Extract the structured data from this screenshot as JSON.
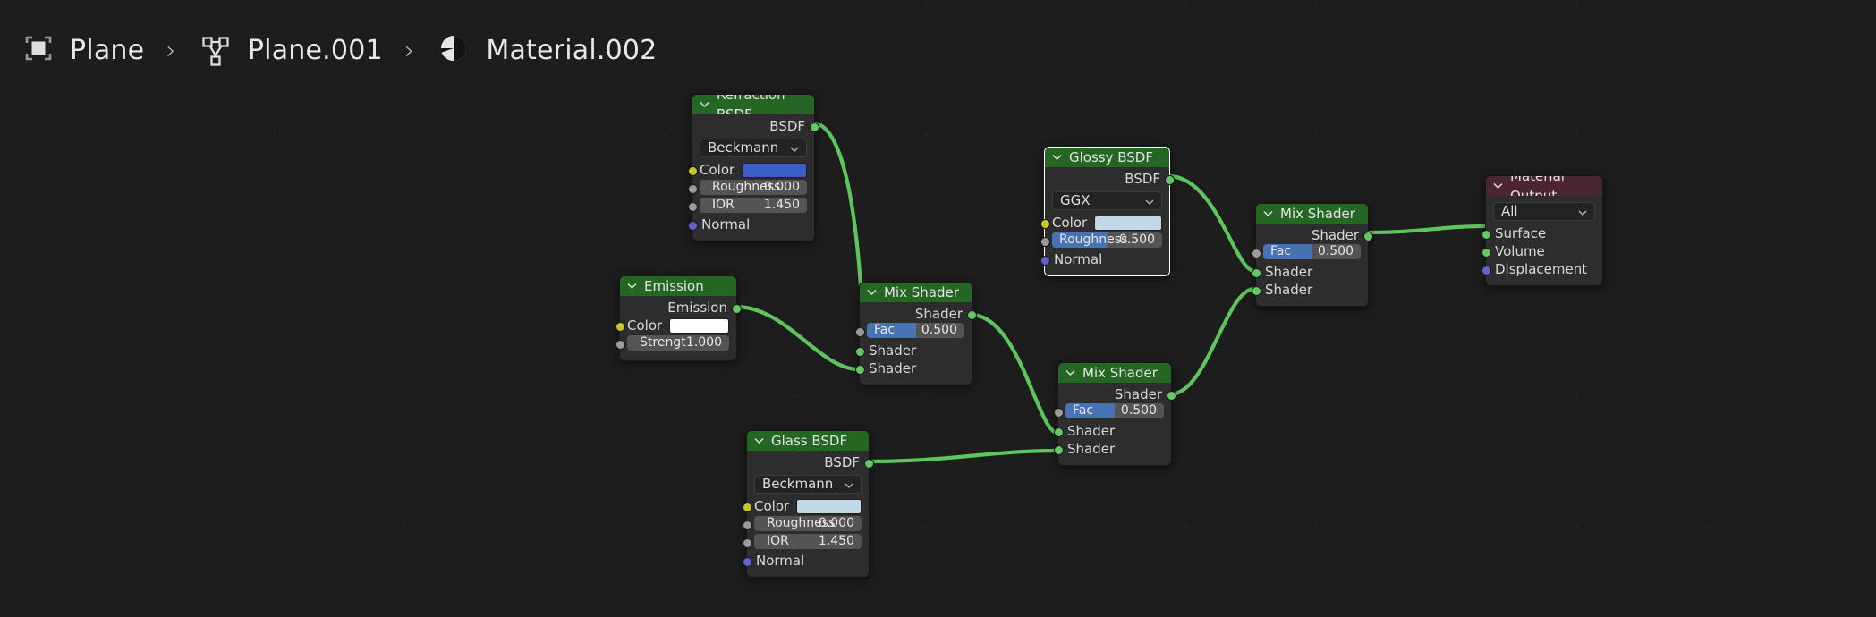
{
  "breadcrumb": {
    "items": [
      {
        "icon": "object-icon",
        "label": "Plane"
      },
      {
        "icon": "mesh-data-icon",
        "label": "Plane.001"
      },
      {
        "icon": "material-icon",
        "label": "Material.002"
      }
    ],
    "separator": "›"
  },
  "colors": {
    "shader_header": "#246622",
    "output_header": "#4b2631",
    "node_body": "#2d2d2d",
    "wire": "#5ec45e",
    "slider_fill": "#4772b3",
    "socket_shader": "#63c763",
    "socket_color": "#c7c729",
    "socket_value": "#9b9b9b",
    "socket_vector": "#6363c7",
    "background": "#1d1d1d"
  },
  "nodes": {
    "refraction_bsdf": {
      "title": "Refraction BSDF",
      "outputs": [
        {
          "label": "BSDF",
          "type": "shader"
        }
      ],
      "distribution": "Beckmann",
      "color_label": "Color",
      "color_value": "#3b5fc4",
      "roughness_label": "Roughness",
      "roughness_value": "0.000",
      "ior_label": "IOR",
      "ior_value": "1.450",
      "normal_label": "Normal"
    },
    "emission": {
      "title": "Emission",
      "outputs": [
        {
          "label": "Emission",
          "type": "shader"
        }
      ],
      "color_label": "Color",
      "color_value": "#ffffff",
      "strength_label": "Strengt",
      "strength_value": "1.000"
    },
    "glass_bsdf": {
      "title": "Glass BSDF",
      "outputs": [
        {
          "label": "BSDF",
          "type": "shader"
        }
      ],
      "distribution": "Beckmann",
      "color_label": "Color",
      "color_value": "#c2dae8",
      "roughness_label": "Roughness",
      "roughness_value": "0.000",
      "ior_label": "IOR",
      "ior_value": "1.450",
      "normal_label": "Normal"
    },
    "glossy_bsdf": {
      "title": "Glossy BSDF",
      "selected": true,
      "outputs": [
        {
          "label": "BSDF",
          "type": "shader"
        }
      ],
      "distribution": "GGX",
      "color_label": "Color",
      "color_value": "#c2dae8",
      "roughness_label": "Roughness",
      "roughness_value": "0.500",
      "roughness_fill_pct": 50,
      "normal_label": "Normal"
    },
    "mix_shader_1": {
      "title": "Mix Shader",
      "output_label": "Shader",
      "fac_label": "Fac",
      "fac_value": "0.500",
      "fac_fill_pct": 50,
      "input_a_label": "Shader",
      "input_b_label": "Shader"
    },
    "mix_shader_2": {
      "title": "Mix Shader",
      "output_label": "Shader",
      "fac_label": "Fac",
      "fac_value": "0.500",
      "fac_fill_pct": 50,
      "input_a_label": "Shader",
      "input_b_label": "Shader"
    },
    "mix_shader_3": {
      "title": "Mix Shader",
      "output_label": "Shader",
      "fac_label": "Fac",
      "fac_value": "0.500",
      "fac_fill_pct": 50,
      "input_a_label": "Shader",
      "input_b_label": "Shader"
    },
    "material_output": {
      "title": "Material Output",
      "target": "All",
      "surface_label": "Surface",
      "volume_label": "Volume",
      "displacement_label": "Displacement"
    }
  }
}
